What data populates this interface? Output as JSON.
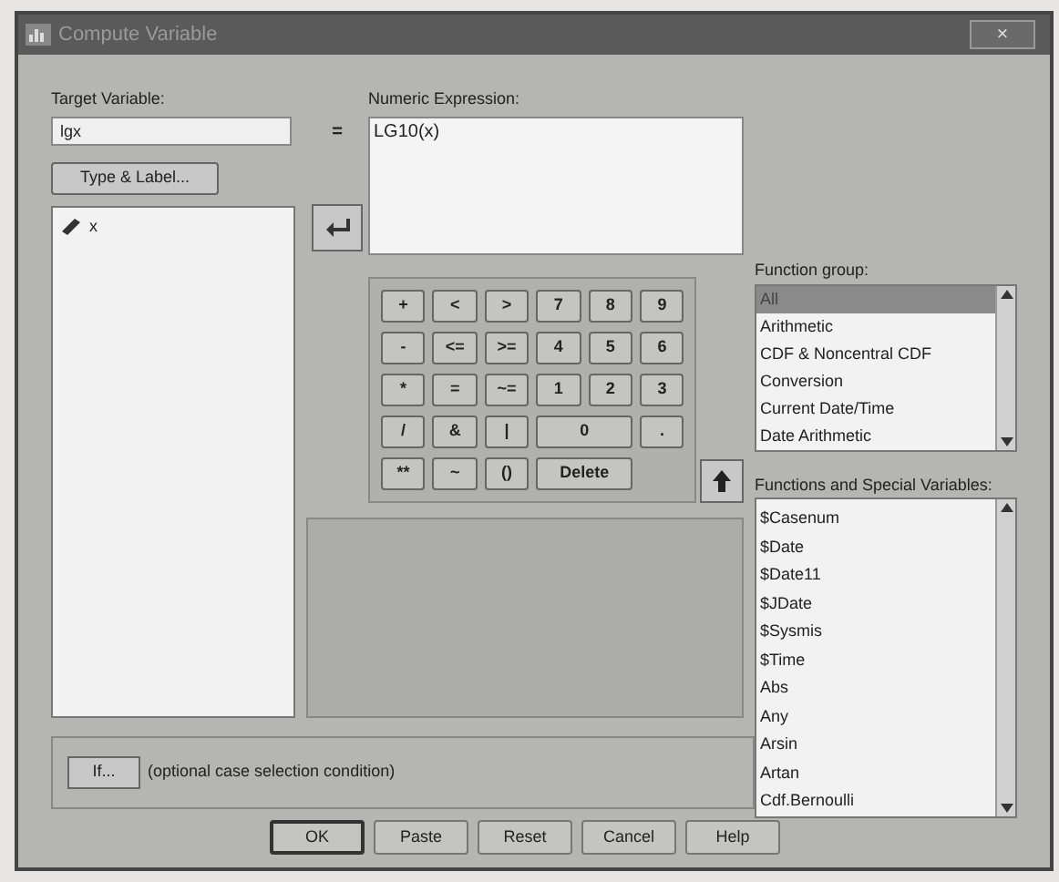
{
  "window": {
    "title": "Compute Variable",
    "close": "×"
  },
  "target_variable": {
    "label": "Target Variable:",
    "value": "lgx",
    "equals": "="
  },
  "type_label_button": "Type & Label...",
  "variables": [
    {
      "name": "x",
      "kind": "scale"
    }
  ],
  "numeric_expression": {
    "label": "Numeric Expression:",
    "value": "LG10(x)"
  },
  "keypad": [
    {
      "label": "+"
    },
    {
      "label": "<"
    },
    {
      "label": ">"
    },
    {
      "label": "7"
    },
    {
      "label": "8"
    },
    {
      "label": "9"
    },
    {
      "label": "-"
    },
    {
      "label": "<="
    },
    {
      "label": ">="
    },
    {
      "label": "4"
    },
    {
      "label": "5"
    },
    {
      "label": "6"
    },
    {
      "label": "*"
    },
    {
      "label": "="
    },
    {
      "label": "~="
    },
    {
      "label": "1"
    },
    {
      "label": "2"
    },
    {
      "label": "3"
    },
    {
      "label": "/"
    },
    {
      "label": "&"
    },
    {
      "label": "|"
    },
    {
      "label": "0",
      "wide": true
    },
    {
      "label": "."
    },
    {
      "label": "**"
    },
    {
      "label": "~"
    },
    {
      "label": "()"
    },
    {
      "label": "Delete",
      "wide": true
    }
  ],
  "function_group": {
    "label": "Function group:",
    "items": [
      {
        "label": "All",
        "selected": true
      },
      {
        "label": "Arithmetic",
        "selected": false
      },
      {
        "label": "CDF & Noncentral CDF",
        "selected": false
      },
      {
        "label": "Conversion",
        "selected": false
      },
      {
        "label": "Current Date/Time",
        "selected": false
      },
      {
        "label": "Date Arithmetic",
        "selected": false
      }
    ]
  },
  "functions": {
    "label": "Functions and Special Variables:",
    "items": [
      "$Casenum",
      "$Date",
      "$Date11",
      "$JDate",
      "$Sysmis",
      "$Time",
      "Abs",
      "Any",
      "Arsin",
      "Artan",
      "Cdf.Bernoulli"
    ]
  },
  "condition": {
    "button": "If...",
    "text": "(optional case selection condition)"
  },
  "buttons": [
    {
      "label": "OK",
      "default": true
    },
    {
      "label": "Paste",
      "default": false
    },
    {
      "label": "Reset",
      "default": false
    },
    {
      "label": "Cancel",
      "default": false
    },
    {
      "label": "Help",
      "default": false
    }
  ]
}
